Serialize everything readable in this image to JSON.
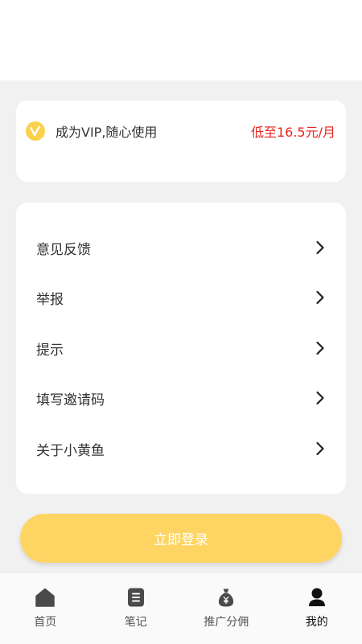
{
  "vip": {
    "title": "成为VIP,随心使用",
    "price": "低至16.5元/月",
    "icon": "vip-badge-icon",
    "price_color": "#e8241d"
  },
  "menu": {
    "items": [
      {
        "label": "意见反馈"
      },
      {
        "label": "举报"
      },
      {
        "label": "提示"
      },
      {
        "label": "填写邀请码"
      },
      {
        "label": "关于小黄鱼"
      }
    ]
  },
  "login": {
    "label": "立即登录",
    "color": "#fed563"
  },
  "tabbar": {
    "active_index": 3,
    "tabs": [
      {
        "label": "首页",
        "icon": "home-icon"
      },
      {
        "label": "笔记",
        "icon": "note-icon"
      },
      {
        "label": "推广分佣",
        "icon": "money-bag-icon"
      },
      {
        "label": "我的",
        "icon": "profile-icon"
      }
    ]
  }
}
